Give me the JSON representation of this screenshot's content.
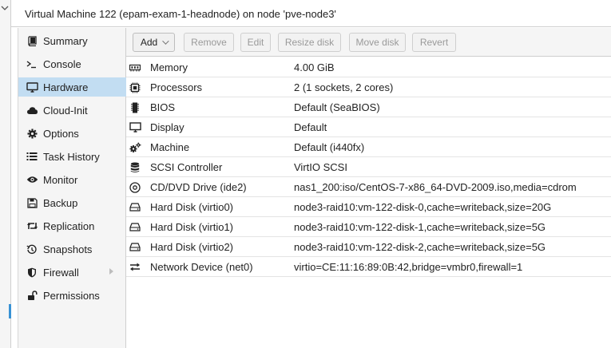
{
  "window": {
    "title": "Virtual Machine 122 (epam-exam-1-headnode) on node 'pve-node3'"
  },
  "sidebar": {
    "items": [
      {
        "label": "Summary",
        "icon": "book-icon"
      },
      {
        "label": "Console",
        "icon": "terminal-icon"
      },
      {
        "label": "Hardware",
        "icon": "desktop-icon",
        "active": true
      },
      {
        "label": "Cloud-Init",
        "icon": "cloud-icon"
      },
      {
        "label": "Options",
        "icon": "gear-icon"
      },
      {
        "label": "Task History",
        "icon": "list-icon"
      },
      {
        "label": "Monitor",
        "icon": "eye-icon"
      },
      {
        "label": "Backup",
        "icon": "floppy-icon"
      },
      {
        "label": "Replication",
        "icon": "retweet-icon"
      },
      {
        "label": "Snapshots",
        "icon": "history-icon"
      },
      {
        "label": "Firewall",
        "icon": "shield-icon",
        "expandable": true
      },
      {
        "label": "Permissions",
        "icon": "unlock-icon"
      }
    ]
  },
  "toolbar": {
    "add_label": "Add",
    "remove_label": "Remove",
    "edit_label": "Edit",
    "resize_label": "Resize disk",
    "move_label": "Move disk",
    "revert_label": "Revert"
  },
  "hardware": [
    {
      "name": "Memory",
      "value": "4.00 GiB",
      "icon": "memory-icon"
    },
    {
      "name": "Processors",
      "value": "2 (1 sockets, 2 cores)",
      "icon": "cpu-icon"
    },
    {
      "name": "BIOS",
      "value": "Default (SeaBIOS)",
      "icon": "microchip-icon"
    },
    {
      "name": "Display",
      "value": "Default",
      "icon": "monitor-icon"
    },
    {
      "name": "Machine",
      "value": "Default (i440fx)",
      "icon": "cogs-icon"
    },
    {
      "name": "SCSI Controller",
      "value": "VirtIO SCSI",
      "icon": "database-icon"
    },
    {
      "name": "CD/DVD Drive (ide2)",
      "value": "nas1_200:iso/CentOS-7-x86_64-DVD-2009.iso,media=cdrom",
      "icon": "cdrom-icon"
    },
    {
      "name": "Hard Disk (virtio0)",
      "value": "node3-raid10:vm-122-disk-0,cache=writeback,size=20G",
      "icon": "hdd-icon"
    },
    {
      "name": "Hard Disk (virtio1)",
      "value": "node3-raid10:vm-122-disk-1,cache=writeback,size=5G",
      "icon": "hdd-icon"
    },
    {
      "name": "Hard Disk (virtio2)",
      "value": "node3-raid10:vm-122-disk-2,cache=writeback,size=5G",
      "icon": "hdd-icon"
    },
    {
      "name": "Network Device (net0)",
      "value": "virtio=CE:11:16:89:0B:42,bridge=vmbr0,firewall=1",
      "icon": "exchange-icon"
    }
  ],
  "colors": {
    "selected_row": "#c2ddf2",
    "accent": "#3892d4"
  }
}
